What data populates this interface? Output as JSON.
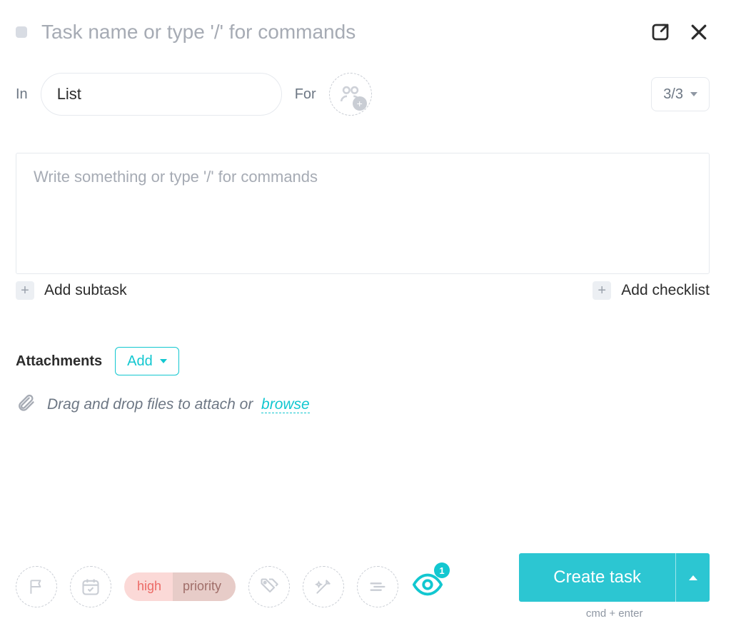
{
  "header": {
    "task_name_placeholder": "Task name or type '/' for commands"
  },
  "meta": {
    "in_label": "In",
    "list_value": "List",
    "for_label": "For",
    "counter": "3/3"
  },
  "description": {
    "placeholder": "Write something or type '/' for commands"
  },
  "quickadd": {
    "subtask": "Add subtask",
    "checklist": "Add checklist"
  },
  "attachments": {
    "title": "Attachments",
    "add_label": "Add",
    "drop_hint": "Drag and drop files to attach or",
    "browse": "browse"
  },
  "toolbar": {
    "priority_high": "high",
    "priority_label": "priority",
    "watch_count": "1"
  },
  "create": {
    "label": "Create task",
    "hint": "cmd + enter"
  }
}
